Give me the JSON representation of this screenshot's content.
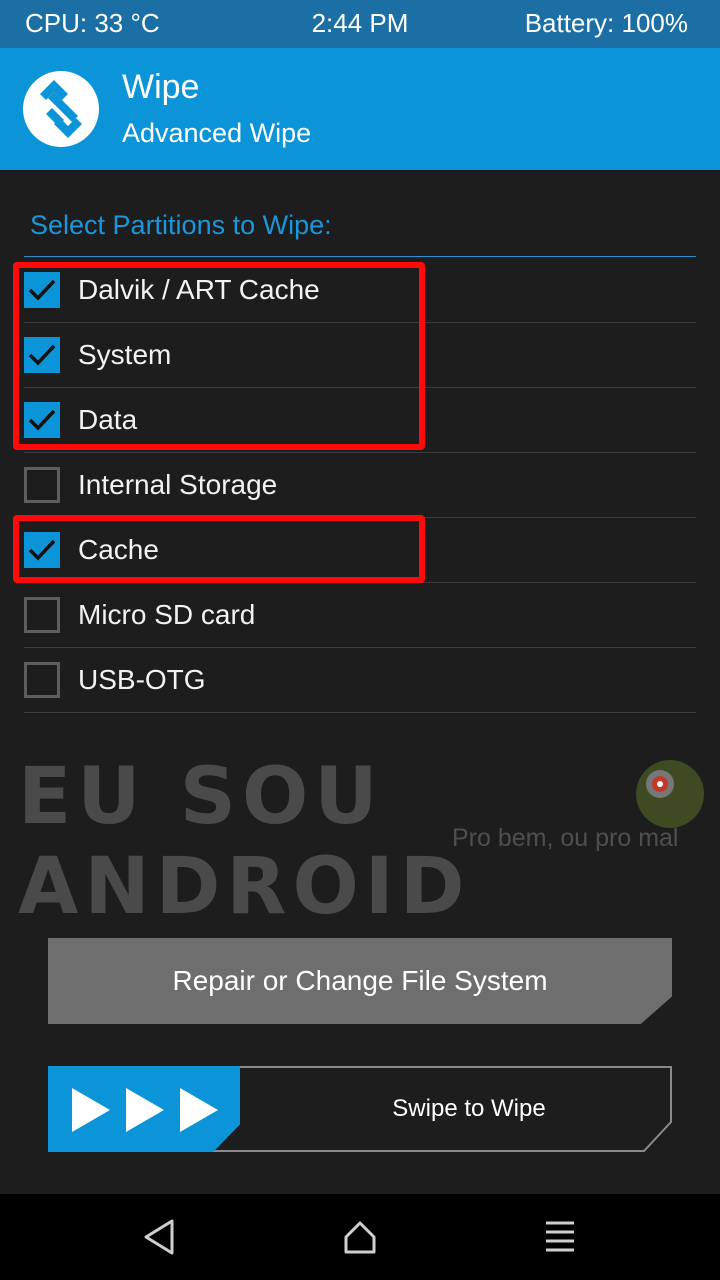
{
  "status_bar": {
    "cpu": "CPU: 33 °C",
    "time": "2:44 PM",
    "battery": "Battery: 100%"
  },
  "header": {
    "title": "Wipe",
    "subtitle": "Advanced Wipe",
    "logo_icon": "twrp-logo-icon"
  },
  "section": {
    "title": "Select Partitions to Wipe:"
  },
  "partitions": [
    {
      "label": "Dalvik / ART Cache",
      "checked": true
    },
    {
      "label": "System",
      "checked": true
    },
    {
      "label": "Data",
      "checked": true
    },
    {
      "label": "Internal Storage",
      "checked": false
    },
    {
      "label": "Cache",
      "checked": true
    },
    {
      "label": "Micro SD card",
      "checked": false
    },
    {
      "label": "USB-OTG",
      "checked": false
    }
  ],
  "watermark": {
    "text": "EU SOU ANDROID",
    "tagline": "Pro bem, ou pro mal"
  },
  "actions": {
    "repair_label": "Repair or Change File System",
    "swipe_label": "Swipe to Wipe"
  },
  "nav": {
    "back_icon": "back-triangle-icon",
    "home_icon": "home-icon",
    "menu_icon": "menu-icon"
  },
  "colors": {
    "accent": "#0c94d8",
    "status_bar": "#1b6fa5",
    "background": "#1d1d1d",
    "highlight": "#ff0a0a"
  }
}
